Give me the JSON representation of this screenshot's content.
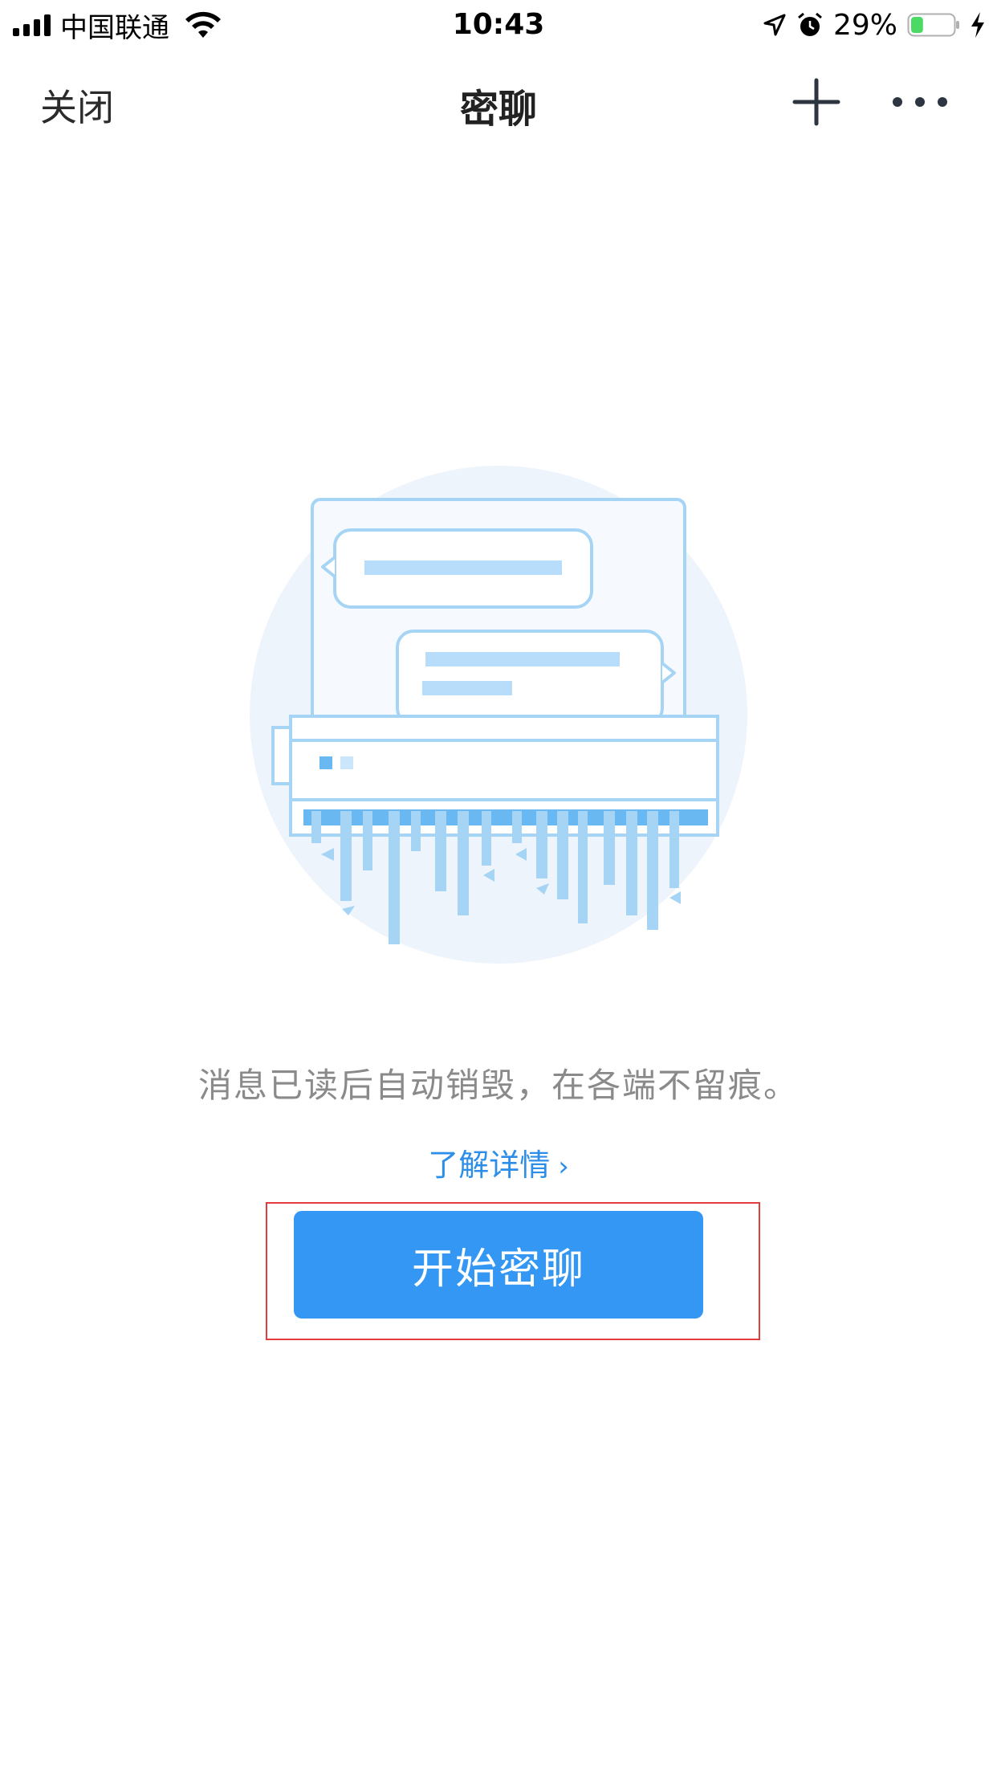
{
  "status_bar": {
    "carrier": "中国联通",
    "time": "10:43",
    "battery_percent": "29%",
    "battery_level": 0.29,
    "icons": [
      "signal-icon",
      "wifi-icon",
      "location-arrow-icon",
      "alarm-icon",
      "battery-icon",
      "charging-bolt-icon"
    ]
  },
  "nav": {
    "close_label": "关闭",
    "title": "密聊",
    "plus_icon": "plus-icon",
    "more_icon": "more-icon"
  },
  "illustration": {
    "icon": "message-shredder-illustration",
    "colors": {
      "circle": "#eef4fb",
      "line": "#a6d4f5",
      "fill": "#b7ddfa",
      "accent": "#6ab8f2"
    }
  },
  "content": {
    "description": "消息已读后自动销毁，在各端不留痕。",
    "learn_more_label": "了解详情",
    "learn_more_chevron": "›",
    "start_button_label": "开始密聊"
  },
  "colors": {
    "primary": "#3497f4",
    "link": "#2c8ee8",
    "highlight_frame": "#e23c3c"
  }
}
